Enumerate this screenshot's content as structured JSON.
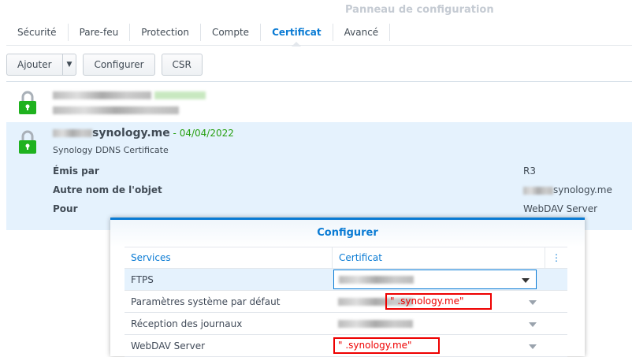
{
  "window": {
    "title": "Panneau de configuration"
  },
  "tabs": [
    {
      "label": "Sécurité"
    },
    {
      "label": "Pare-feu"
    },
    {
      "label": "Protection"
    },
    {
      "label": "Compte"
    },
    {
      "label": "Certificat",
      "active": true
    },
    {
      "label": "Avancé"
    }
  ],
  "toolbar": {
    "add": "Ajouter",
    "configure": "Configurer",
    "csr": "CSR"
  },
  "certificates": [
    {
      "name": "",
      "date": "",
      "desc": ""
    },
    {
      "name_suffix": "synology.me",
      "date_sep": " - ",
      "date": "04/04/2022",
      "desc": "Synology DDNS Certificate",
      "details": [
        {
          "label": "Émis par",
          "value": "R3"
        },
        {
          "label": "Autre nom de l'objet",
          "value": "synology.me"
        },
        {
          "label": "Pour",
          "value": "WebDAV Server"
        }
      ]
    }
  ],
  "dialog": {
    "title": "Configurer",
    "columns": [
      "Services",
      "Certificat",
      "⋮"
    ],
    "rows": [
      {
        "service": "FTPS"
      },
      {
        "service": "Paramètres système par défaut",
        "annotation": "\"   .synology.me\""
      },
      {
        "service": "Réception des journaux"
      },
      {
        "service": "WebDAV Server",
        "annotation": "\"   .synology.me\""
      }
    ]
  },
  "colors": {
    "accent": "#0a7bd4",
    "lock": "#1fb21f",
    "annotation": "#ee0000"
  }
}
